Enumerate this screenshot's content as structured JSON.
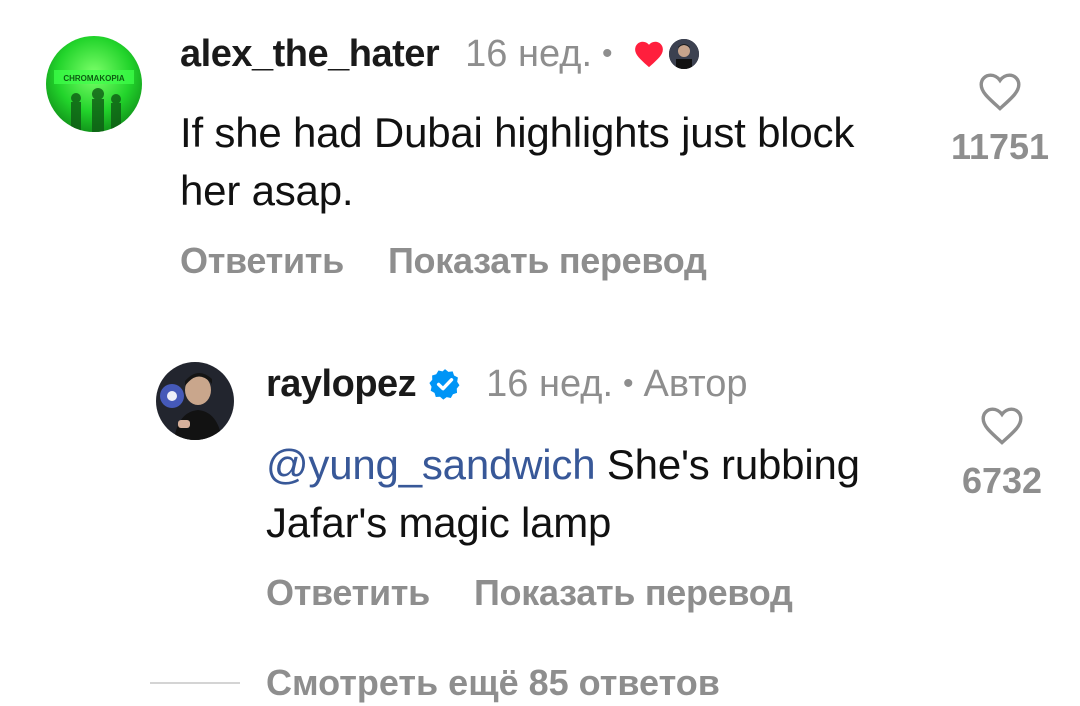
{
  "comments": [
    {
      "username": "alex_the_hater",
      "time": "16 нед.",
      "dot": "•",
      "text": "If she had Dubai highlights just block her asap.",
      "reply_label": "Ответить",
      "translate_label": "Показать перевод",
      "likes": "11751",
      "avatar_text": "CHROMAKOPIA",
      "author_liked": true
    },
    {
      "username": "raylopez",
      "verified": true,
      "time": "16 нед.",
      "dot": "•",
      "author_tag": "Автор",
      "mention": "@yung_sandwich",
      "text": " She's rubbing Jafar's magic lamp",
      "reply_label": "Ответить",
      "translate_label": "Показать перевод",
      "likes": "6732"
    }
  ],
  "view_more_label": "Смотреть ещё 85 ответов",
  "colors": {
    "heart_red": "#ff1f3d",
    "verified_blue": "#0095f6",
    "mention_blue": "#385898",
    "muted_gray": "#8e8e8e",
    "avatar_green": "#2ee83a"
  },
  "icons": [
    "heart-outline-icon",
    "heart-filled-icon",
    "verified-badge-icon"
  ]
}
